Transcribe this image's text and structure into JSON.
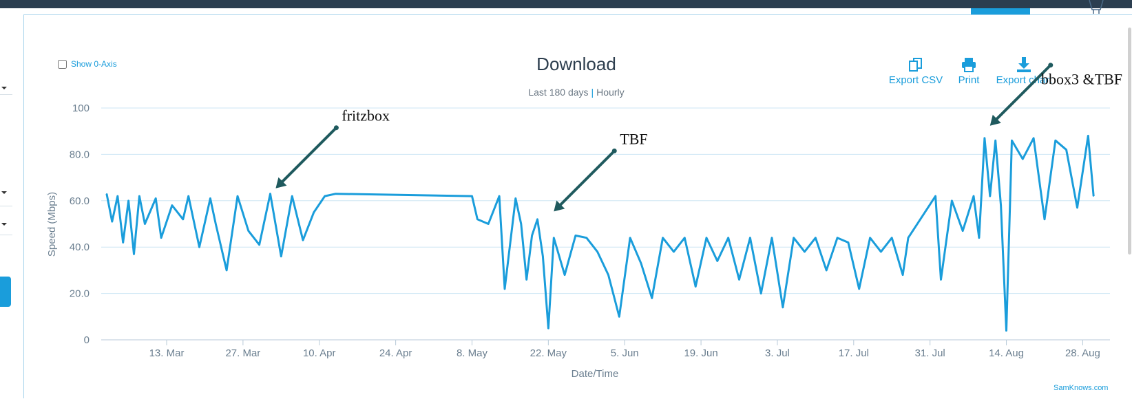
{
  "show_zero_axis_label": "Show 0-Axis",
  "title": "Download",
  "subtitle_range": "Last 180 days",
  "subtitle_separator": "|",
  "subtitle_granularity": "Hourly",
  "actions": [
    {
      "label": "Export CSV",
      "icon": "copy-icon"
    },
    {
      "label": "Print",
      "icon": "printer-icon"
    },
    {
      "label": "Export chart",
      "icon": "download-icon"
    }
  ],
  "credit": "SamKnows.com",
  "colors": {
    "series": "#1a9ddb",
    "arrow": "#1f5a5e",
    "topbar": "#2b3e50"
  },
  "chart_data": {
    "type": "line",
    "title": "Download",
    "subtitle": "Last 180 days | Hourly",
    "xlabel": "Date/Time",
    "ylabel": "Speed (Mbps)",
    "ylim": [
      0,
      100
    ],
    "y_ticks": [
      "0",
      "20.0",
      "40.0",
      "60.0",
      "80.0",
      "100"
    ],
    "x_ticks": [
      "13. Mar",
      "27. Mar",
      "10. Apr",
      "24. Apr",
      "8. May",
      "22. May",
      "5. Jun",
      "19. Jun",
      "3. Jul",
      "17. Jul",
      "31. Jul",
      "14. Aug",
      "28. Aug"
    ],
    "grid": true,
    "legend": "none",
    "series": [
      {
        "points": [
          [
            "2017-03-02",
            63
          ],
          [
            "2017-03-03",
            51
          ],
          [
            "2017-03-04",
            62
          ],
          [
            "2017-03-05",
            42
          ],
          [
            "2017-03-06",
            60
          ],
          [
            "2017-03-07",
            37
          ],
          [
            "2017-03-08",
            62
          ],
          [
            "2017-03-09",
            50
          ],
          [
            "2017-03-11",
            61
          ],
          [
            "2017-03-12",
            44
          ],
          [
            "2017-03-14",
            58
          ],
          [
            "2017-03-16",
            52
          ],
          [
            "2017-03-17",
            62
          ],
          [
            "2017-03-19",
            40
          ],
          [
            "2017-03-21",
            61
          ],
          [
            "2017-03-22",
            50
          ],
          [
            "2017-03-24",
            30
          ],
          [
            "2017-03-26",
            62
          ],
          [
            "2017-03-28",
            47
          ],
          [
            "2017-03-30",
            41
          ],
          [
            "2017-04-01",
            63
          ],
          [
            "2017-04-03",
            36
          ],
          [
            "2017-04-05",
            62
          ],
          [
            "2017-04-07",
            43
          ],
          [
            "2017-04-09",
            55
          ],
          [
            "2017-04-11",
            62
          ],
          [
            "2017-04-13",
            63
          ],
          [
            "2017-05-08",
            62
          ],
          [
            "2017-05-09",
            52
          ],
          [
            "2017-05-11",
            50
          ],
          [
            "2017-05-13",
            62
          ],
          [
            "2017-05-14",
            22
          ],
          [
            "2017-05-16",
            61
          ],
          [
            "2017-05-17",
            50
          ],
          [
            "2017-05-18",
            26
          ],
          [
            "2017-05-19",
            45
          ],
          [
            "2017-05-20",
            52
          ],
          [
            "2017-05-21",
            36
          ],
          [
            "2017-05-22",
            5
          ],
          [
            "2017-05-23",
            44
          ],
          [
            "2017-05-25",
            28
          ],
          [
            "2017-05-27",
            45
          ],
          [
            "2017-05-29",
            44
          ],
          [
            "2017-05-31",
            38
          ],
          [
            "2017-06-02",
            28
          ],
          [
            "2017-06-04",
            10
          ],
          [
            "2017-06-06",
            44
          ],
          [
            "2017-06-08",
            33
          ],
          [
            "2017-06-10",
            18
          ],
          [
            "2017-06-12",
            44
          ],
          [
            "2017-06-14",
            38
          ],
          [
            "2017-06-16",
            44
          ],
          [
            "2017-06-18",
            23
          ],
          [
            "2017-06-20",
            44
          ],
          [
            "2017-06-22",
            34
          ],
          [
            "2017-06-24",
            44
          ],
          [
            "2017-06-26",
            26
          ],
          [
            "2017-06-28",
            44
          ],
          [
            "2017-06-30",
            20
          ],
          [
            "2017-07-02",
            44
          ],
          [
            "2017-07-04",
            14
          ],
          [
            "2017-07-06",
            44
          ],
          [
            "2017-07-08",
            38
          ],
          [
            "2017-07-10",
            44
          ],
          [
            "2017-07-12",
            30
          ],
          [
            "2017-07-14",
            44
          ],
          [
            "2017-07-16",
            42
          ],
          [
            "2017-07-18",
            22
          ],
          [
            "2017-07-20",
            44
          ],
          [
            "2017-07-22",
            38
          ],
          [
            "2017-07-24",
            44
          ],
          [
            "2017-07-26",
            28
          ],
          [
            "2017-07-27",
            44
          ],
          [
            "2017-08-01",
            62
          ],
          [
            "2017-08-02",
            26
          ],
          [
            "2017-08-04",
            60
          ],
          [
            "2017-08-06",
            47
          ],
          [
            "2017-08-08",
            62
          ],
          [
            "2017-08-09",
            44
          ],
          [
            "2017-08-10",
            87
          ],
          [
            "2017-08-11",
            62
          ],
          [
            "2017-08-12",
            86
          ],
          [
            "2017-08-13",
            58
          ],
          [
            "2017-08-14",
            4
          ],
          [
            "2017-08-15",
            86
          ],
          [
            "2017-08-17",
            78
          ],
          [
            "2017-08-19",
            87
          ],
          [
            "2017-08-21",
            52
          ],
          [
            "2017-08-23",
            86
          ],
          [
            "2017-08-25",
            82
          ],
          [
            "2017-08-27",
            57
          ],
          [
            "2017-08-29",
            88
          ],
          [
            "2017-08-30",
            62
          ]
        ]
      }
    ],
    "annotations": [
      {
        "text": "fritzbox",
        "x": "2017-04-02",
        "y": 63
      },
      {
        "text": "TBF",
        "x": "2017-05-23",
        "y": 53
      },
      {
        "text": "bbox3 &TBF",
        "x": "2017-08-11",
        "y": 90
      }
    ]
  }
}
